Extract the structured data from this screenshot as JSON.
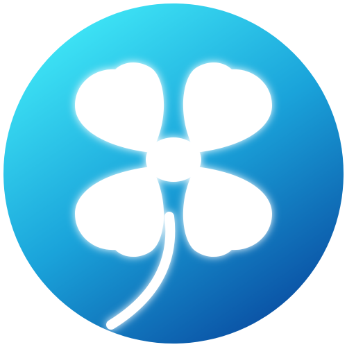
{
  "logo": {
    "icon": "four-leaf-clover-icon",
    "colors": {
      "gradient_top_left": "#3fe6f6",
      "gradient_mid": "#1aa3da",
      "gradient_bottom_right": "#0a4fa3",
      "clover": "#ffffff",
      "glow": "#bff6ff"
    }
  }
}
